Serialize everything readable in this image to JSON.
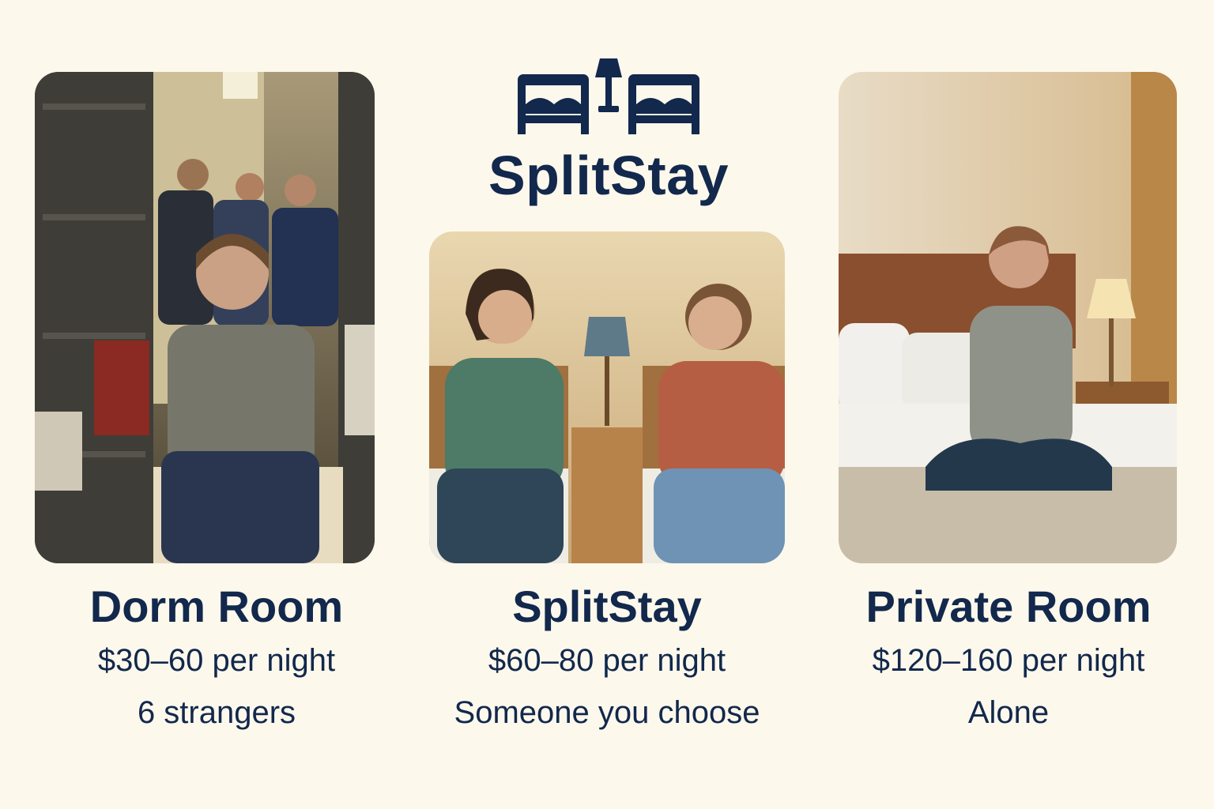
{
  "brand": {
    "name": "SplitStay",
    "logo_icon": "two-beds-with-lamp-icon",
    "color": "#12284c",
    "background": "#fdf8ec"
  },
  "options": [
    {
      "id": "dorm",
      "title": "Dorm Room",
      "price": "$30–60 per night",
      "note": "6 strangers",
      "image": "dorm-room-photo"
    },
    {
      "id": "splitstay",
      "title": "SplitStay",
      "price": "$60–80 per night",
      "note": "Someone you choose",
      "image": "shared-room-photo"
    },
    {
      "id": "private",
      "title": "Private Room",
      "price": "$120–160 per night",
      "note": "Alone",
      "image": "private-room-photo"
    }
  ]
}
